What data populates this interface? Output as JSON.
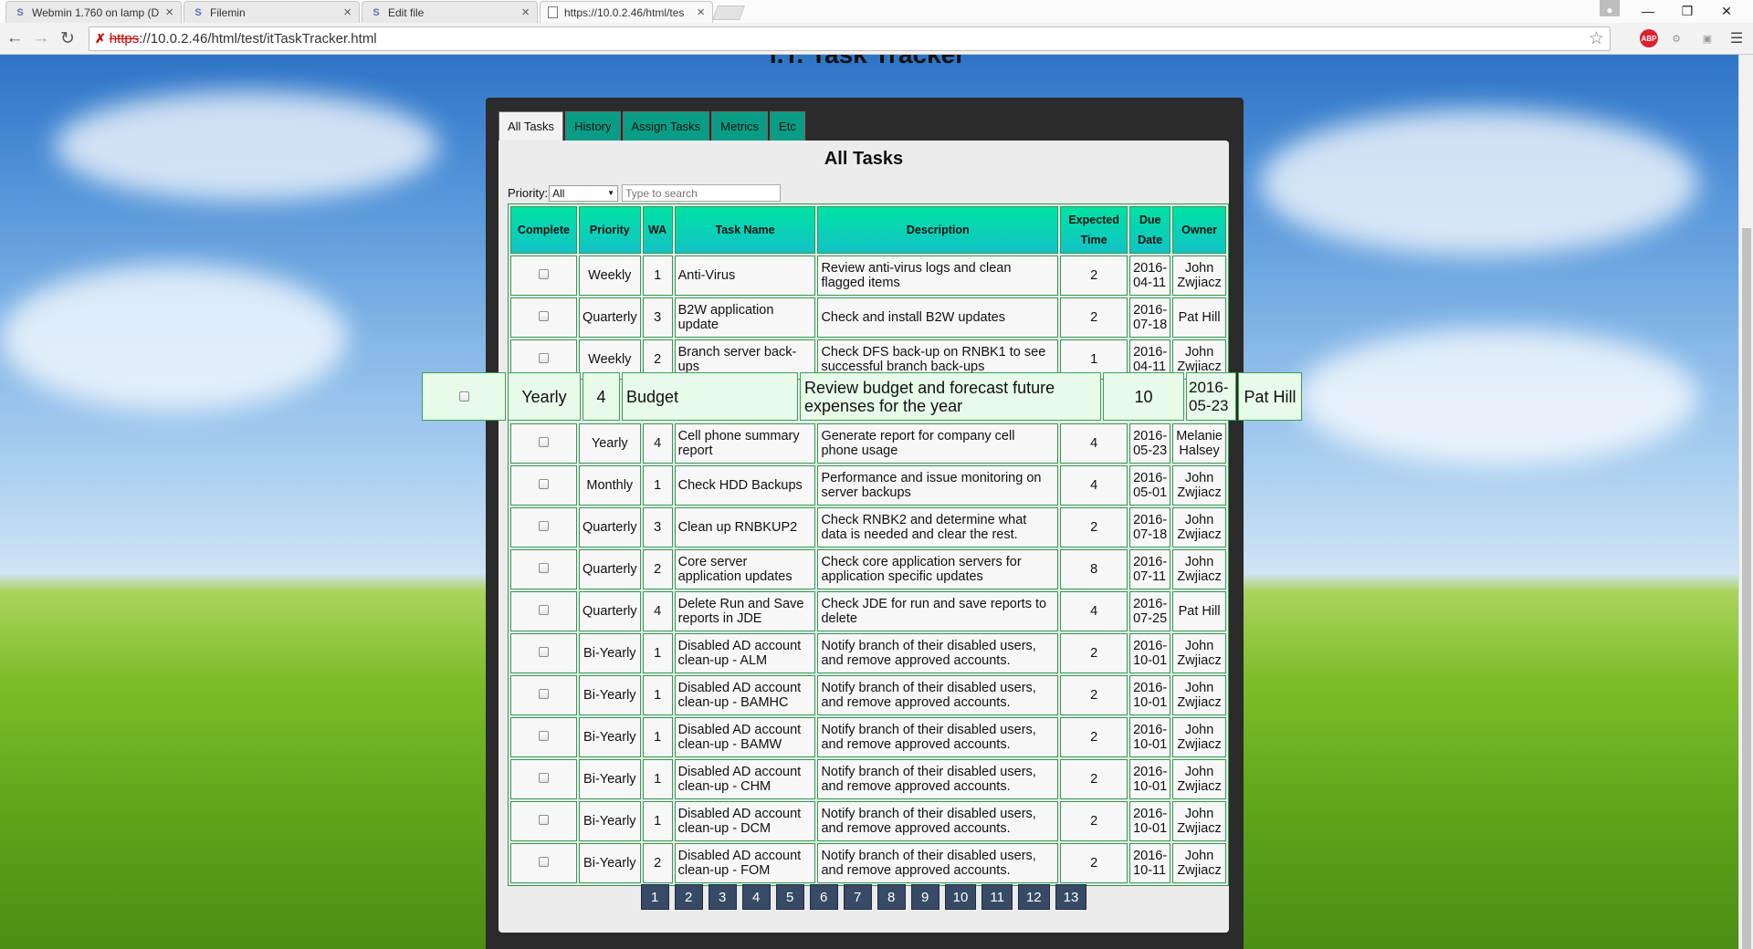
{
  "browser": {
    "tabs": [
      {
        "favicon": "webmin-icon",
        "title": "Webmin 1.760 on lamp (D"
      },
      {
        "favicon": "webmin-icon",
        "title": "Filemin"
      },
      {
        "favicon": "webmin-icon",
        "title": "Edit file"
      },
      {
        "favicon": "page-icon",
        "title": "https://10.0.2.46/html/tes"
      }
    ],
    "url_scheme": "https",
    "url_rest": "://10.0.2.46/html/test/itTaskTracker.html",
    "extensions": [
      "adblock-plus-icon",
      "extension-icon",
      "cast-icon",
      "menu-icon"
    ]
  },
  "page": {
    "title": "I.T. Task Tracker",
    "tabs": [
      "All Tasks",
      "History",
      "Assign Tasks",
      "Metrics",
      "Etc"
    ],
    "active_tab": "All Tasks",
    "heading": "All Tasks",
    "filter": {
      "priority_label": "Priority:",
      "priority_value": "All",
      "search_placeholder": "Type to search"
    }
  },
  "table": {
    "columns": [
      "Complete",
      "Priority",
      "WA",
      "Task Name",
      "Description",
      "Expected Time",
      "Due Date",
      "Owner"
    ],
    "rows": [
      {
        "priority": "Weekly",
        "wa": "1",
        "name": "Anti-Virus",
        "desc": "Review anti-virus logs and clean flagged items",
        "time": "2",
        "due": "2016-04-11",
        "owner": "John Zwjiacz"
      },
      {
        "priority": "Quarterly",
        "wa": "3",
        "name": "B2W application update",
        "desc": "Check and install B2W updates",
        "time": "2",
        "due": "2016-07-18",
        "owner": "Pat Hill"
      },
      {
        "priority": "Weekly",
        "wa": "2",
        "name": "Branch server back-ups",
        "desc": "Check DFS back-up on RNBK1 to see successful branch back-ups",
        "time": "1",
        "due": "2016-04-11",
        "owner": "John Zwjiacz"
      },
      {
        "priority": "Yearly",
        "wa": "4",
        "name": "Budget",
        "desc": "Review budget and forecast future expenses for the year",
        "time": "10",
        "due": "2016-05-23",
        "owner": "Pat Hill"
      },
      {
        "priority": "Yearly",
        "wa": "4",
        "name": "Cell phone summary report",
        "desc": "Generate report for company cell phone usage",
        "time": "4",
        "due": "2016-05-23",
        "owner": "Melanie Halsey"
      },
      {
        "priority": "Monthly",
        "wa": "1",
        "name": "Check HDD Backups",
        "desc": "Performance and issue monitoring on server backups",
        "time": "4",
        "due": "2016-05-01",
        "owner": "John Zwjiacz"
      },
      {
        "priority": "Quarterly",
        "wa": "3",
        "name": "Clean up RNBKUP2",
        "desc": "Check RNBK2 and determine what data is needed and clear the rest.",
        "time": "2",
        "due": "2016-07-18",
        "owner": "John Zwjiacz"
      },
      {
        "priority": "Quarterly",
        "wa": "2",
        "name": "Core server application updates",
        "desc": "Check core application servers for application specific updates",
        "time": "8",
        "due": "2016-07-11",
        "owner": "John Zwjiacz"
      },
      {
        "priority": "Quarterly",
        "wa": "4",
        "name": "Delete Run and Save reports in JDE",
        "desc": "Check JDE for run and save reports to delete",
        "time": "4",
        "due": "2016-07-25",
        "owner": "Pat Hill"
      },
      {
        "priority": "Bi-Yearly",
        "wa": "1",
        "name": "Disabled AD account clean-up - ALM",
        "desc": "Notify branch of their disabled users, and remove approved accounts.",
        "time": "2",
        "due": "2016-10-01",
        "owner": "John Zwjiacz"
      },
      {
        "priority": "Bi-Yearly",
        "wa": "1",
        "name": "Disabled AD account clean-up - BAMHC",
        "desc": "Notify branch of their disabled users, and remove approved accounts.",
        "time": "2",
        "due": "2016-10-01",
        "owner": "John Zwjiacz"
      },
      {
        "priority": "Bi-Yearly",
        "wa": "1",
        "name": "Disabled AD account clean-up - BAMW",
        "desc": "Notify branch of their disabled users, and remove approved accounts.",
        "time": "2",
        "due": "2016-10-01",
        "owner": "John Zwjiacz"
      },
      {
        "priority": "Bi-Yearly",
        "wa": "1",
        "name": "Disabled AD account clean-up - CHM",
        "desc": "Notify branch of their disabled users, and remove approved accounts.",
        "time": "2",
        "due": "2016-10-01",
        "owner": "John Zwjiacz"
      },
      {
        "priority": "Bi-Yearly",
        "wa": "1",
        "name": "Disabled AD account clean-up - DCM",
        "desc": "Notify branch of their disabled users, and remove approved accounts.",
        "time": "2",
        "due": "2016-10-01",
        "owner": "John Zwjiacz"
      },
      {
        "priority": "Bi-Yearly",
        "wa": "2",
        "name": "Disabled AD account clean-up - FOM",
        "desc": "Notify branch of their disabled users, and remove approved accounts.",
        "time": "2",
        "due": "2016-10-11",
        "owner": "John Zwjiacz"
      }
    ],
    "dragged_row_index": 3
  },
  "pagination": [
    "1",
    "2",
    "3",
    "4",
    "5",
    "6",
    "7",
    "8",
    "9",
    "10",
    "11",
    "12",
    "13"
  ]
}
